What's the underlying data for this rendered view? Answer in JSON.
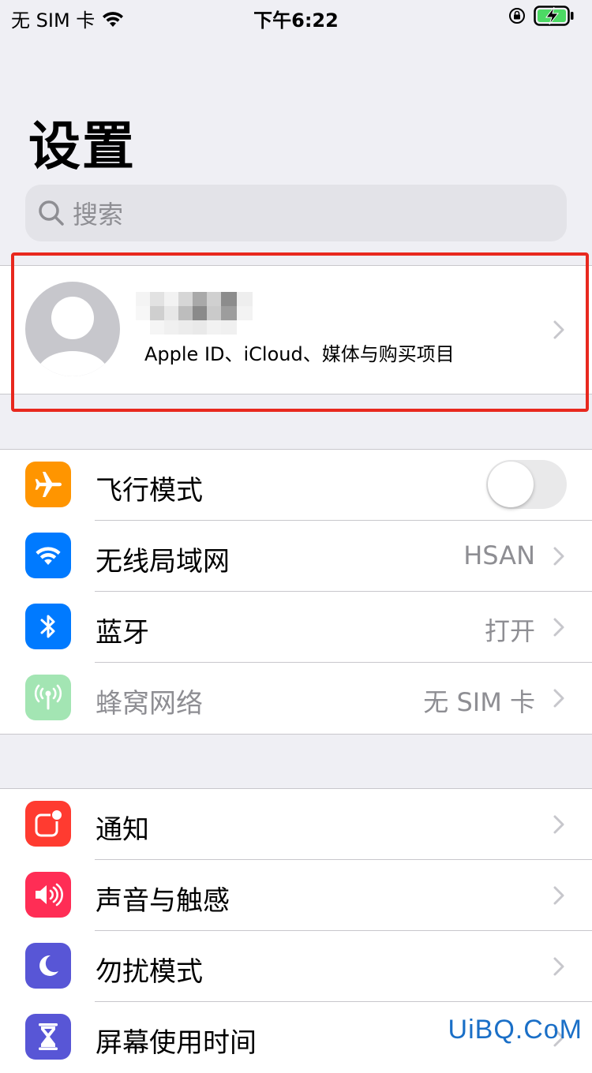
{
  "status_bar": {
    "carrier": "无 SIM 卡",
    "time": "下午6:22"
  },
  "title": "设置",
  "search": {
    "placeholder": "搜索"
  },
  "profile": {
    "subtitle": "Apple ID、iCloud、媒体与购买项目"
  },
  "group1": [
    {
      "label": "飞行模式",
      "icon": "airplane-icon",
      "color": "#ff9500",
      "toggle": false
    },
    {
      "label": "无线局域网",
      "value": "HSAN",
      "icon": "wifi-icon",
      "color": "#007aff"
    },
    {
      "label": "蓝牙",
      "value": "打开",
      "icon": "bluetooth-icon",
      "color": "#007aff"
    },
    {
      "label": "蜂窝网络",
      "value": "无 SIM 卡",
      "icon": "cellular-icon",
      "color": "#34c759",
      "disabled": true
    }
  ],
  "group2": [
    {
      "label": "通知",
      "icon": "notifications-icon",
      "color": "#ff3b30"
    },
    {
      "label": "声音与触感",
      "icon": "sound-icon",
      "color": "#ff2d55"
    },
    {
      "label": "勿扰模式",
      "icon": "moon-icon",
      "color": "#5856d6"
    },
    {
      "label": "屏幕使用时间",
      "icon": "hourglass-icon",
      "color": "#5856d6"
    }
  ],
  "watermark": "UiBQ.CoM"
}
